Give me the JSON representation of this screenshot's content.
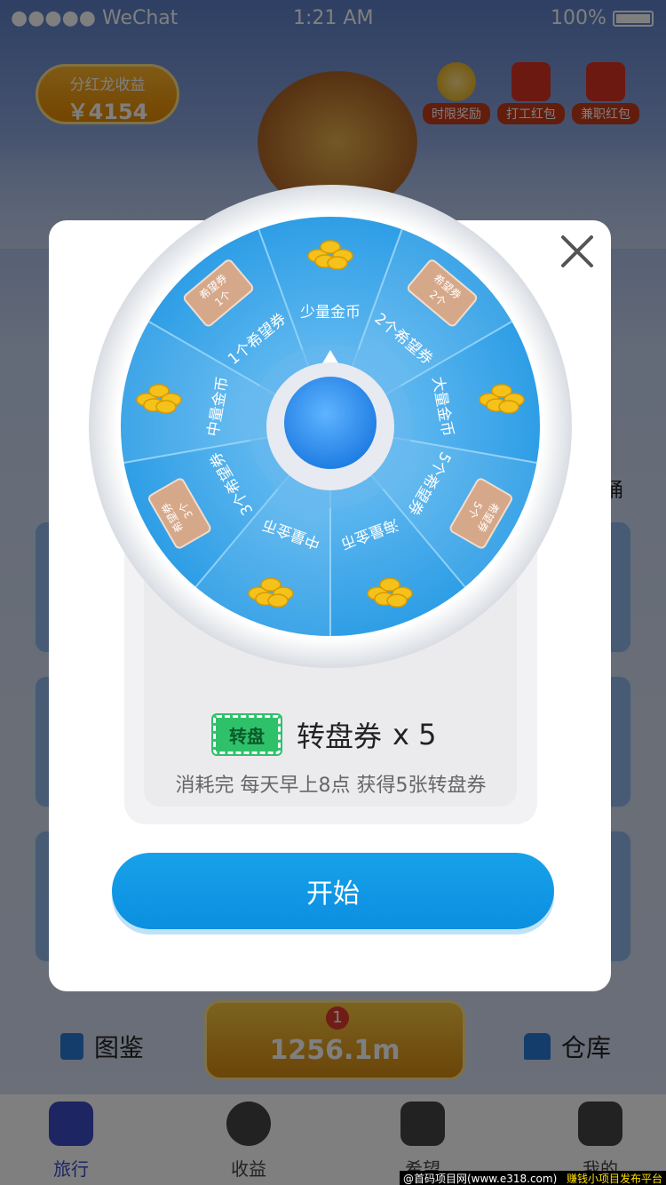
{
  "status_bar": {
    "carrier": "●●●●● WeChat",
    "time": "1:21 AM",
    "battery": "100%"
  },
  "header": {
    "dividend_label": "分红龙收益",
    "dividend_value": "￥4154",
    "limited_reward": "时限奖励",
    "work_red_packet": "打工红包",
    "parttime_red_packet": "兼职红包"
  },
  "side": {
    "bucket_label": "桶"
  },
  "bottom_actions": {
    "book_label": "图鉴",
    "warehouse_label": "仓库",
    "coin_badge": "1",
    "coin_value": "1256.1m"
  },
  "tabs": [
    {
      "label": "旅行",
      "active": true
    },
    {
      "label": "收益"
    },
    {
      "label": "希望"
    },
    {
      "label": "我的"
    }
  ],
  "watermark": {
    "left": "@首码项目网(www.e318.com)",
    "right": "赚钱小项目发布平台"
  },
  "modal": {
    "wheel_segments": [
      {
        "label": "少量金币",
        "prize": "coins"
      },
      {
        "label": "2个希望券",
        "prize": "ticket",
        "ticket_line1": "希望券",
        "ticket_line2": "2个"
      },
      {
        "label": "大量金币",
        "prize": "coins"
      },
      {
        "label": "5个希望券",
        "prize": "ticket",
        "ticket_line1": "希望券",
        "ticket_line2": "5个"
      },
      {
        "label": "海量金币",
        "prize": "coins"
      },
      {
        "label": "中量金币",
        "prize": "coins"
      },
      {
        "label": "3个希望券",
        "prize": "ticket",
        "ticket_line1": "希望券",
        "ticket_line2": "3个"
      },
      {
        "label": "中量金币",
        "prize": "coins"
      },
      {
        "label": "1个希望券",
        "prize": "ticket",
        "ticket_line1": "希望券",
        "ticket_line2": "1个"
      }
    ],
    "ticket_icon_text": "转盘",
    "ticket_name": "转盘券",
    "ticket_count": "x 5",
    "ticket_desc": "消耗完 每天早上8点 获得5张转盘券",
    "start_button": "开始"
  },
  "colors": {
    "accent": "#0b93e3",
    "wheel_blue": "#3ea8ec",
    "ticket_green": "#2fc16a"
  }
}
